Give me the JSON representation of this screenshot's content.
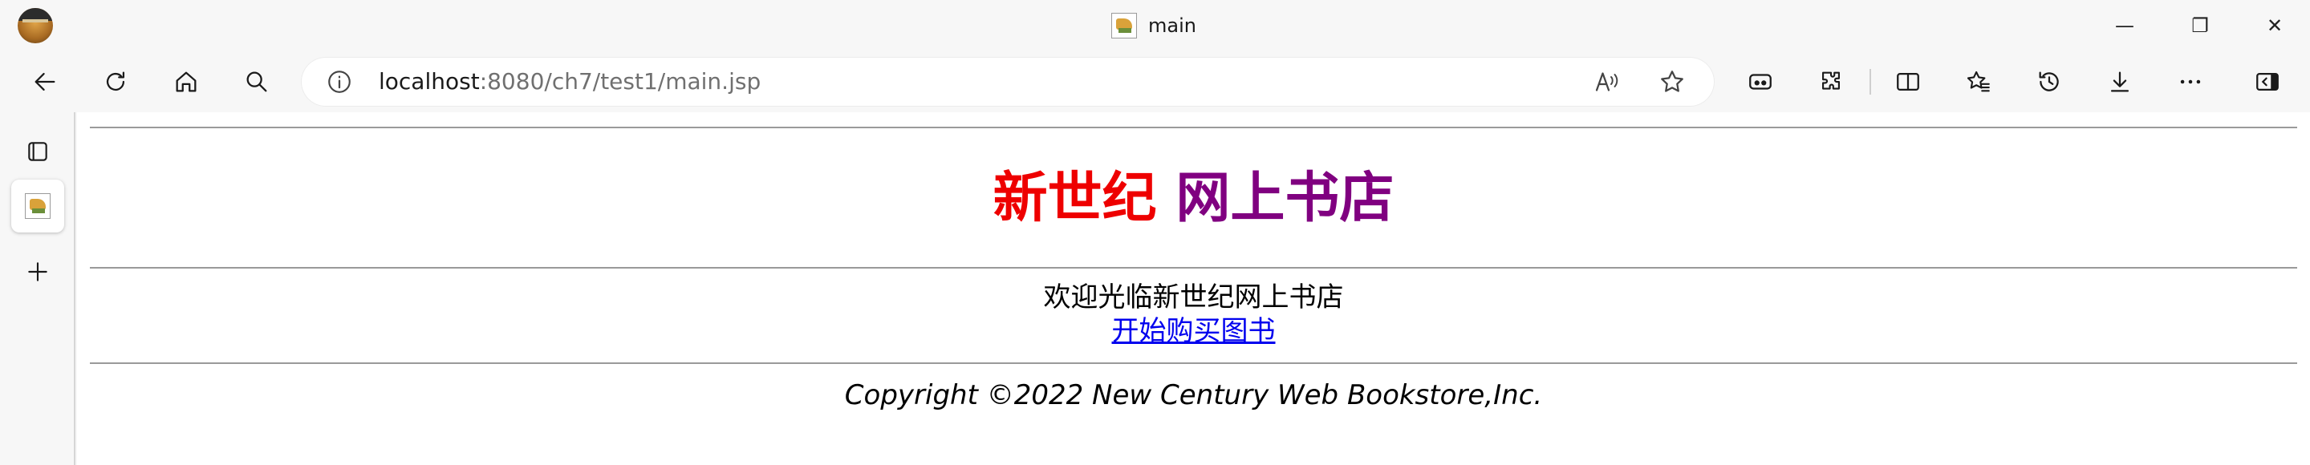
{
  "window": {
    "tab_title": "main",
    "controls": {
      "minimize": "—",
      "restore": "❐",
      "close": "✕"
    }
  },
  "toolbar": {
    "url_host": "localhost",
    "url_path": ":8080/ch7/test1/main.jsp",
    "icons": [
      "back-icon",
      "refresh-icon",
      "home-icon",
      "search-icon",
      "info-icon",
      "read-aloud-icon",
      "favorite-icon",
      "tab-actions-icon",
      "extensions-icon",
      "split-screen-icon",
      "favorites-icon",
      "history-icon",
      "downloads-icon",
      "more-icon",
      "sidebar-toggle-icon"
    ]
  },
  "sidebar": {
    "icons": [
      "tab-actions-icon",
      "tab-favicon",
      "new-tab-icon"
    ]
  },
  "page": {
    "heading_red": "新世纪",
    "heading_purple": "网上书店",
    "welcome_text": "欢迎光临新世纪网上书店",
    "link_text": "开始购买图书",
    "copyright": "Copyright ©2022 New Century Web Bookstore,Inc.",
    "colors": {
      "heading_red": "#ee0000",
      "heading_purple": "#800080",
      "link": "#0000ee"
    }
  }
}
